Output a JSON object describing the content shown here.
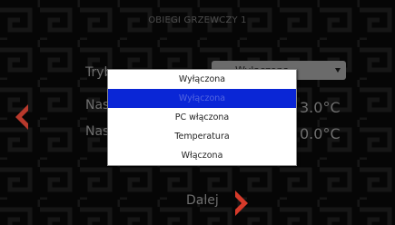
{
  "screen": {
    "title": "OBIEGI GRZEWCZY 1"
  },
  "rows": {
    "mode_label": "Tryb",
    "setpoint1_label": "Nas",
    "setpoint1_value": "3.0°C",
    "setpoint2_label": "Nas",
    "setpoint2_value": "0.0°C"
  },
  "mode_select": {
    "value": "Wyłączona"
  },
  "dropdown": {
    "options": [
      {
        "label": "Wyłączona",
        "selected": false
      },
      {
        "label": "Wyłączona",
        "selected": true
      },
      {
        "label": "PC włączona",
        "selected": false
      },
      {
        "label": "Temperatura",
        "selected": false
      },
      {
        "label": "Włączona",
        "selected": false
      }
    ]
  },
  "navigation": {
    "next_label": "Dalej",
    "prev_icon": "chevron-left-icon",
    "next_icon": "chevron-right-icon"
  },
  "colors": {
    "accent_arrow": "#d63a2a",
    "selected_option": "#0a26d6"
  }
}
